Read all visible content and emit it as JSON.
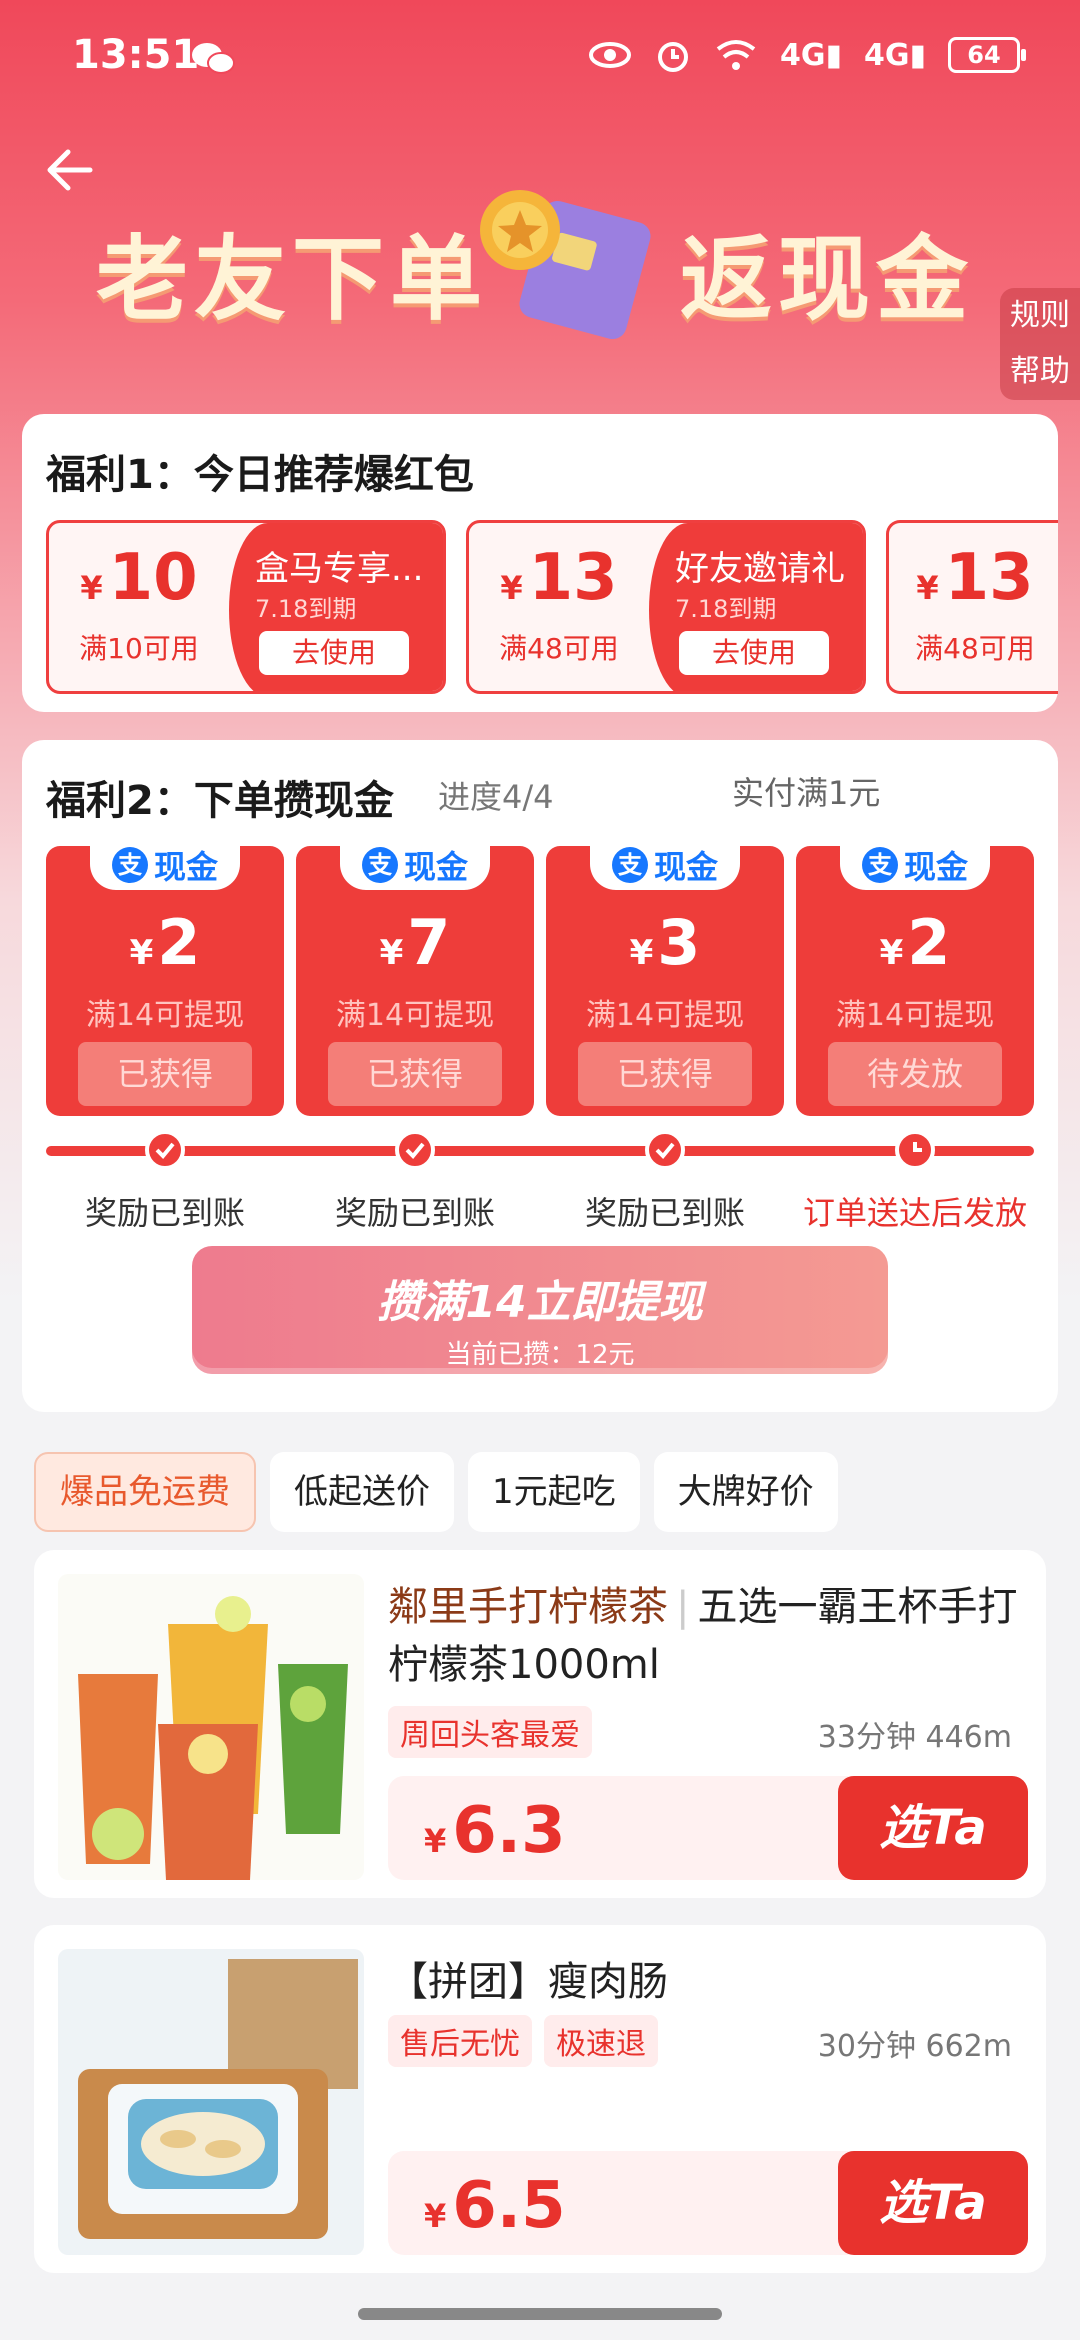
{
  "status": {
    "time": "13:51",
    "battery": "64"
  },
  "header": {
    "title_left": "老友下单",
    "title_right": "返现金",
    "side_rules": "规则",
    "side_help": "帮助"
  },
  "benefit1": {
    "title": "福利1：今日推荐爆红包",
    "coupons": [
      {
        "currency": "¥",
        "amount": "10",
        "condition": "满10可用",
        "name": "盒马专享...",
        "expiry": "7.18到期",
        "button": "去使用"
      },
      {
        "currency": "¥",
        "amount": "13",
        "condition": "满48可用",
        "name": "好友邀请礼",
        "expiry": "7.18到期",
        "button": "去使用"
      },
      {
        "currency": "¥",
        "amount": "13",
        "condition": "满48可用"
      }
    ]
  },
  "benefit2": {
    "title": "福利2：下单攒现金",
    "progress": "进度4/4",
    "requirement": "实付满1元",
    "cash_label": "现金",
    "alipay_glyph": "支",
    "cards": [
      {
        "currency": "¥",
        "amount": "2",
        "sub": "满14可提现",
        "button": "已获得",
        "step": "奖励已到账"
      },
      {
        "currency": "¥",
        "amount": "7",
        "sub": "满14可提现",
        "button": "已获得",
        "step": "奖励已到账"
      },
      {
        "currency": "¥",
        "amount": "3",
        "sub": "满14可提现",
        "button": "已获得",
        "step": "奖励已到账"
      },
      {
        "currency": "¥",
        "amount": "2",
        "sub": "满14可提现",
        "button": "待发放",
        "step": "订单送达后发放"
      }
    ],
    "cta_main": "攒满14立即提现",
    "cta_sub": "当前已攒：12元"
  },
  "filters": [
    "爆品免运费",
    "低起送价",
    "1元起吃",
    "大牌好价"
  ],
  "products": [
    {
      "shop": "鄰里手打柠檬茶",
      "name": "五选一霸王杯手打柠檬茶1000ml",
      "tags": [
        "周回头客最爱"
      ],
      "meta": "33分钟 446m",
      "currency": "¥",
      "price": "6.3",
      "button": "选Ta"
    },
    {
      "shop": "",
      "name": "【拼团】瘦肉肠",
      "tags": [
        "售后无忧",
        "极速退"
      ],
      "meta": "30分钟 662m",
      "currency": "¥",
      "price": "6.5",
      "button": "选Ta"
    }
  ]
}
